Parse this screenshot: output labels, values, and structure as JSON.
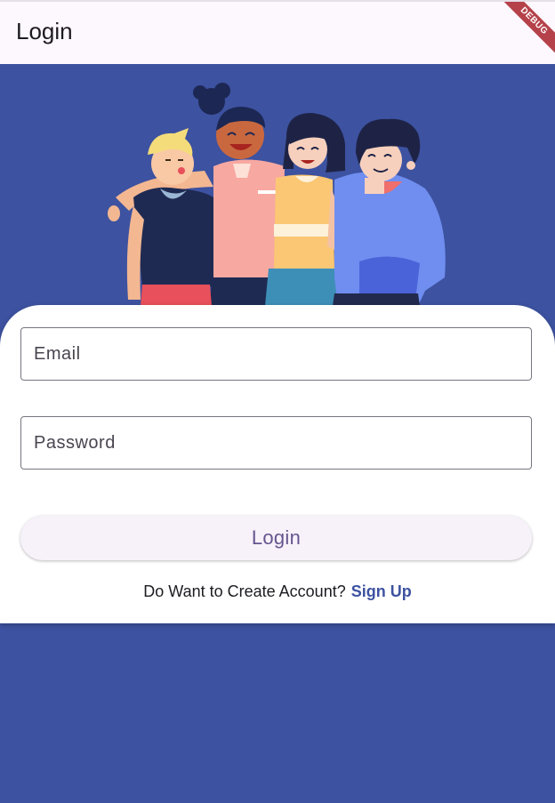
{
  "appbar": {
    "title": "Login",
    "debug_label": "DEBUG"
  },
  "form": {
    "email_placeholder": "Email",
    "password_placeholder": "Password",
    "login_label": "Login",
    "signup_prompt": "Do Want to Create Account?",
    "signup_link": "Sign Up"
  },
  "colors": {
    "background": "#3d52a0",
    "appbar": "#fdf7fe",
    "button_text": "#65558f",
    "link": "#3d52a0"
  },
  "icons": [
    "friends-illustration"
  ]
}
